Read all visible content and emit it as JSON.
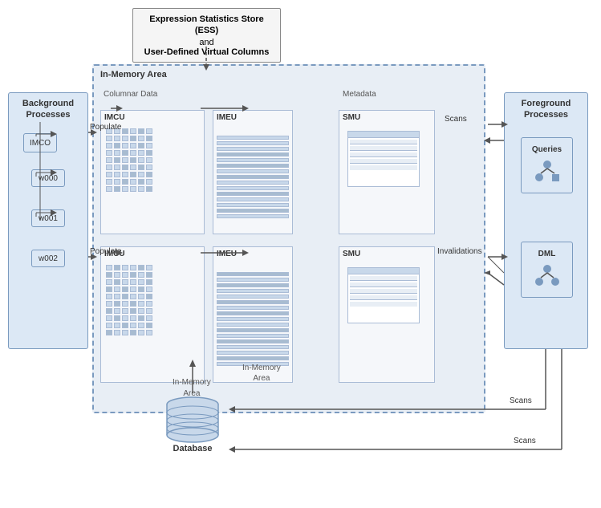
{
  "ess": {
    "title": "Expression Statistics Store (ESS)",
    "subtitle": "and",
    "subtitle2": "User-Defined Virtual Columns"
  },
  "background": {
    "title": "Background\nProcesses",
    "imco": "IMCO",
    "workers": [
      "w000",
      "w001",
      "w002"
    ],
    "populate": "Populate"
  },
  "inmemory": {
    "title": "In-Memory Area",
    "columnar": "Columnar Data",
    "metadata": "Metadata",
    "imcu_label": "IMCU",
    "imeu_label": "IMEU",
    "smu_label": "SMU",
    "inmemory_area_label": "In-Memory\nArea"
  },
  "foreground": {
    "title": "Foreground\nProcesses",
    "queries": "Queries",
    "dml": "DML"
  },
  "arrows": {
    "scans_top": "Scans",
    "scans_mid": "Scans",
    "scans_bot": "Scans",
    "invalidations": "Invalidations",
    "populate": "Populate",
    "database": "Database"
  }
}
